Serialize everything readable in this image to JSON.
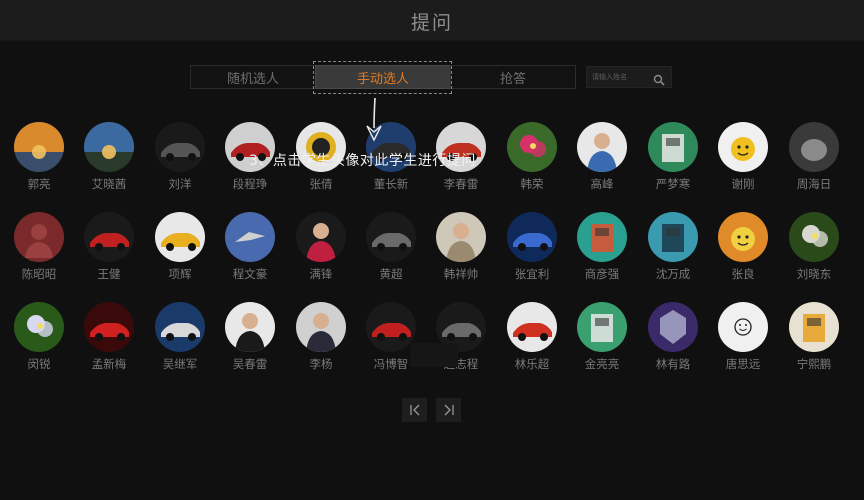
{
  "header": {
    "title": "提问"
  },
  "tabs": {
    "random": "随机选人",
    "manual": "手动选人",
    "grab": "抢答"
  },
  "search": {
    "placeholder": "请输入姓名"
  },
  "tip": "3、点击学生头像对此学生进行提问",
  "students": [
    {
      "name": "郭亮",
      "icon": "sunset-avatar",
      "c1": "#d88a2c",
      "c2": "#3a4d6a"
    },
    {
      "name": "艾晓茜",
      "icon": "city-avatar",
      "c1": "#3b6aa0",
      "c2": "#2a3a2a"
    },
    {
      "name": "刘洋",
      "icon": "car-avatar",
      "c1": "#1a1a1a",
      "c2": "#555555"
    },
    {
      "name": "段程琤",
      "icon": "car-avatar",
      "c1": "#cfcfcf",
      "c2": "#b02020"
    },
    {
      "name": "张倩",
      "icon": "wheel-avatar",
      "c1": "#e6e6e6",
      "c2": "#e0b020"
    },
    {
      "name": "董长新",
      "icon": "car-avatar",
      "c1": "#1f3e6e",
      "c2": "#2a2a2a"
    },
    {
      "name": "李春雷",
      "icon": "car-avatar",
      "c1": "#d7d7d7",
      "c2": "#c03020"
    },
    {
      "name": "韩荣",
      "icon": "flower-avatar",
      "c1": "#3a6a2a",
      "c2": "#d8306a"
    },
    {
      "name": "高峰",
      "icon": "person-avatar",
      "c1": "#e8e8e8",
      "c2": "#3a6ab0"
    },
    {
      "name": "严梦寒",
      "icon": "building-avatar",
      "c1": "#2e8a5a",
      "c2": "#e8e8e8"
    },
    {
      "name": "谢刚",
      "icon": "cartoon-avatar",
      "c1": "#f0f0f0",
      "c2": "#f0c020"
    },
    {
      "name": "周海日",
      "icon": "animal-avatar",
      "c1": "#8a8a8a",
      "c2": "#3a3a3a"
    },
    {
      "name": "陈昭昭",
      "icon": "default-avatar",
      "c1": "#7a2a2a",
      "c2": "#9a4040"
    },
    {
      "name": "王健",
      "icon": "car-avatar",
      "c1": "#1a1a1a",
      "c2": "#c02020"
    },
    {
      "name": "项辉",
      "icon": "car-avatar",
      "c1": "#e8e8e8",
      "c2": "#e8b020"
    },
    {
      "name": "程文豪",
      "icon": "bird-avatar",
      "c1": "#4a6ab0",
      "c2": "#d0d0d0"
    },
    {
      "name": "满锋",
      "icon": "person-avatar",
      "c1": "#1a1a1a",
      "c2": "#c02040"
    },
    {
      "name": "黄超",
      "icon": "car-avatar",
      "c1": "#1a1a1a",
      "c2": "#6a6a6a"
    },
    {
      "name": "韩祥帅",
      "icon": "person-avatar",
      "c1": "#cfc7b8",
      "c2": "#9a8a70"
    },
    {
      "name": "张宜利",
      "icon": "car-avatar",
      "c1": "#0f2a5a",
      "c2": "#3a6ad0"
    },
    {
      "name": "商彦强",
      "icon": "building-avatar",
      "c1": "#2aa090",
      "c2": "#e05030"
    },
    {
      "name": "沈万成",
      "icon": "device-avatar",
      "c1": "#3a9ab0",
      "c2": "#1a3a4a"
    },
    {
      "name": "张良",
      "icon": "cartoon-avatar",
      "c1": "#e08a2a",
      "c2": "#f0d040"
    },
    {
      "name": "刘晓东",
      "icon": "flower-avatar",
      "c1": "#2a4a1a",
      "c2": "#d8d8d0"
    },
    {
      "name": "闵锐",
      "icon": "flower-avatar",
      "c1": "#2a5a1a",
      "c2": "#d8d8f0"
    },
    {
      "name": "孟新梅",
      "icon": "car-avatar",
      "c1": "#3a0a0a",
      "c2": "#d02020"
    },
    {
      "name": "吴继军",
      "icon": "car-avatar",
      "c1": "#1a3a6a",
      "c2": "#d8d8d8"
    },
    {
      "name": "吴春雷",
      "icon": "person-avatar",
      "c1": "#e8e8e8",
      "c2": "#1a1a1a"
    },
    {
      "name": "李杨",
      "icon": "person-avatar",
      "c1": "#d0d0d0",
      "c2": "#2a2a3a"
    },
    {
      "name": "冯博智",
      "icon": "car-avatar",
      "c1": "#1a1a1a",
      "c2": "#c02020"
    },
    {
      "name": "赵志程",
      "icon": "car-avatar",
      "c1": "#1a1a1a",
      "c2": "#6a6a6a"
    },
    {
      "name": "林乐超",
      "icon": "car-avatar",
      "c1": "#e8e8e8",
      "c2": "#d03020"
    },
    {
      "name": "金亮亮",
      "icon": "device-avatar",
      "c1": "#3aa070",
      "c2": "#e8e8e8"
    },
    {
      "name": "林有路",
      "icon": "badge-avatar",
      "c1": "#3a2a6a",
      "c2": "#b0b0d0"
    },
    {
      "name": "唐思远",
      "icon": "smile-avatar",
      "c1": "#f0f0f0",
      "c2": "#222222"
    },
    {
      "name": "宁熙鹏",
      "icon": "device-avatar",
      "c1": "#e8e0d0",
      "c2": "#e8a020"
    }
  ]
}
